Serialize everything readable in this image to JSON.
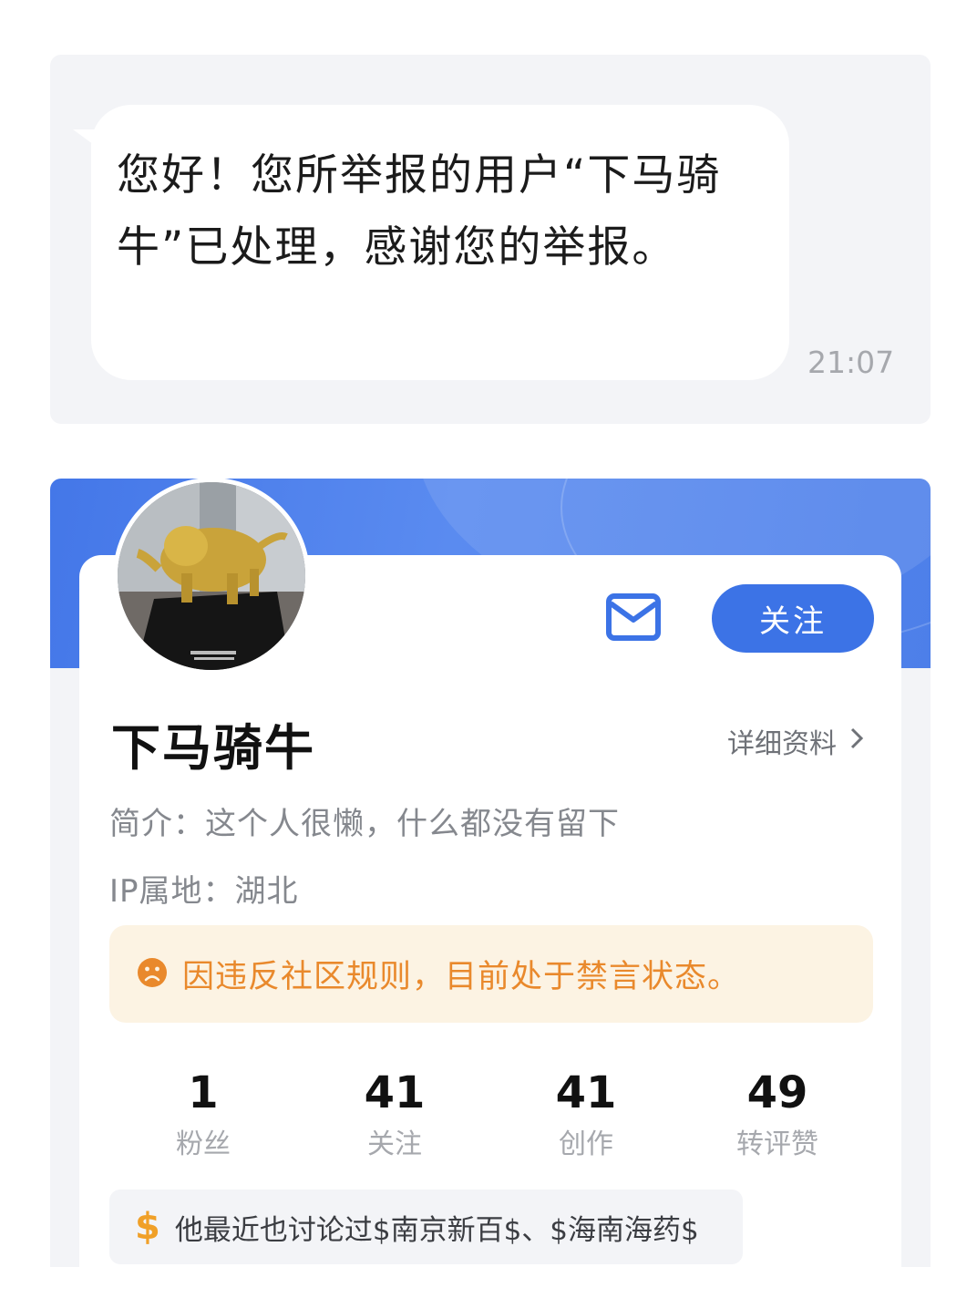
{
  "message": {
    "text": "您好！您所举报的用户“下马骑牛”已处理，感谢您的举报。",
    "time": "21:07"
  },
  "profile": {
    "avatar_icon": "bull-statue-avatar",
    "follow_label": "关注",
    "username": "下马骑牛",
    "detail_link": "详细资料",
    "bio": "简介：这个人很懒，什么都没有留下",
    "ip": "IP属地：湖北",
    "warning": "因违反社区规则，目前处于禁言状态。",
    "stats": [
      {
        "value": "1",
        "label": "粉丝"
      },
      {
        "value": "41",
        "label": "关注"
      },
      {
        "value": "41",
        "label": "创作"
      },
      {
        "value": "49",
        "label": "转评赞"
      }
    ],
    "topic": "他最近也讨论过$南京新百$、$海南海药$"
  },
  "colors": {
    "accent": "#3c73e6",
    "warning_text": "#e9892c",
    "warning_bg": "#fcf3e3",
    "dollar": "#f0a028"
  }
}
